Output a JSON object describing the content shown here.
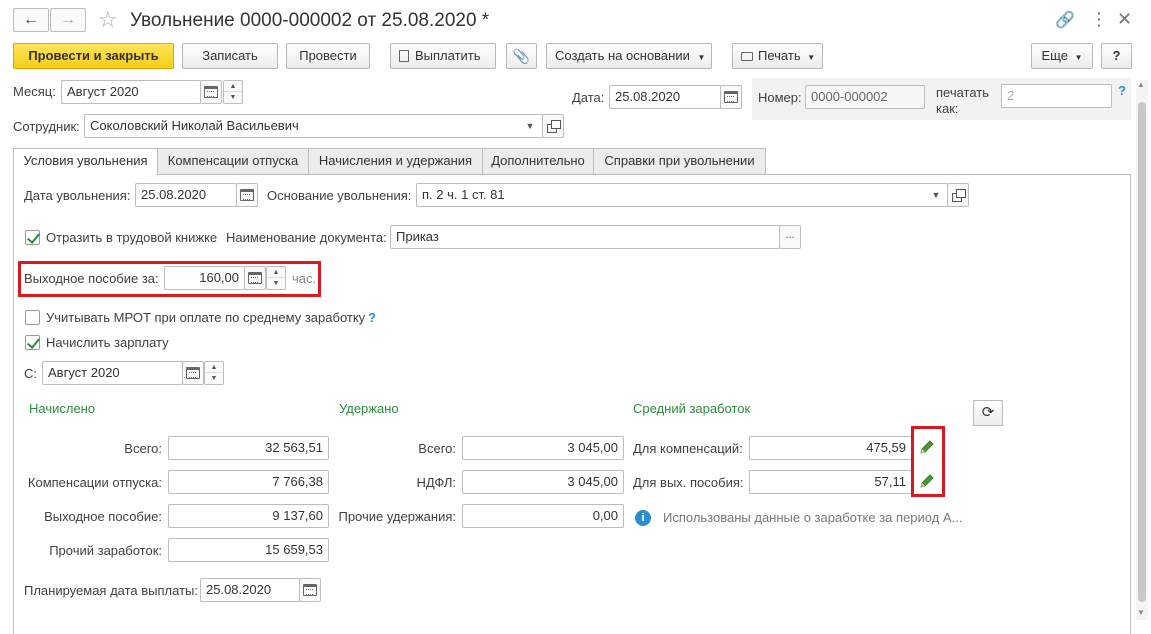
{
  "window": {
    "title": "Увольнение 0000-000002 от 25.08.2020 *"
  },
  "toolbar": {
    "post_close": "Провести и закрыть",
    "save": "Записать",
    "post": "Провести",
    "pay": "Выплатить",
    "create_based": "Создать на основании",
    "print": "Печать",
    "more": "Еще",
    "help": "?"
  },
  "header": {
    "month_label": "Месяц:",
    "month_value": "Август 2020",
    "date_label": "Дата:",
    "date_value": "25.08.2020",
    "number_label": "Номер:",
    "number_value": "0000-000002",
    "print_as_label_1": "печатать",
    "print_as_label_2": "как:",
    "print_as_value": "2",
    "help_mark": "?",
    "employee_label": "Сотрудник:",
    "employee_value": "Соколовский Николай Васильевич"
  },
  "tabs": [
    {
      "label": "Условия увольнения"
    },
    {
      "label": "Компенсации отпуска"
    },
    {
      "label": "Начисления и удержания"
    },
    {
      "label": "Дополнительно"
    },
    {
      "label": "Справки при увольнении"
    }
  ],
  "conditions": {
    "dismissal_date_label": "Дата увольнения:",
    "dismissal_date_value": "25.08.2020",
    "basis_label": "Основание увольнения:",
    "basis_value": "п. 2 ч. 1 ст. 81",
    "workbook_checkbox": "Отразить в трудовой книжке",
    "workbook_checked": true,
    "doc_name_label": "Наименование документа:",
    "doc_name_value": "Приказ",
    "severance_label": "Выходное пособие за:",
    "severance_value": "160,00",
    "severance_unit": "час.",
    "mrot_checkbox": "Учитывать МРОТ при оплате по среднему заработку",
    "mrot_checked": false,
    "mrot_help": "?",
    "salary_checkbox": "Начислить зарплату",
    "salary_checked": true,
    "from_label": "С:",
    "from_value": "Август 2020"
  },
  "accrued": {
    "title": "Начислено",
    "total_label": "Всего:",
    "total_value": "32 563,51",
    "vacation_label": "Компенсации отпуска:",
    "vacation_value": "7 766,38",
    "severance_label": "Выходное пособие:",
    "severance_value": "9 137,60",
    "other_label": "Прочий заработок:",
    "other_value": "15 659,53"
  },
  "withheld": {
    "title": "Удержано",
    "total_label": "Всего:",
    "total_value": "3 045,00",
    "ndfl_label": "НДФЛ:",
    "ndfl_value": "3 045,00",
    "other_label": "Прочие удержания:",
    "other_value": "0,00"
  },
  "average": {
    "title": "Средний заработок",
    "comp_label": "Для компенсаций:",
    "comp_value": "475,59",
    "sev_label": "Для вых. пособия:",
    "sev_value": "57,11",
    "info_text": "Использованы данные о заработке за период А..."
  },
  "payment": {
    "label": "Планируемая дата выплаты:",
    "value": "25.08.2020"
  },
  "colors": {
    "accent_green": "#2e8b3e",
    "primary_button": "#f6cd17",
    "highlight_red": "#d71920",
    "info_blue": "#2a8fd1"
  }
}
